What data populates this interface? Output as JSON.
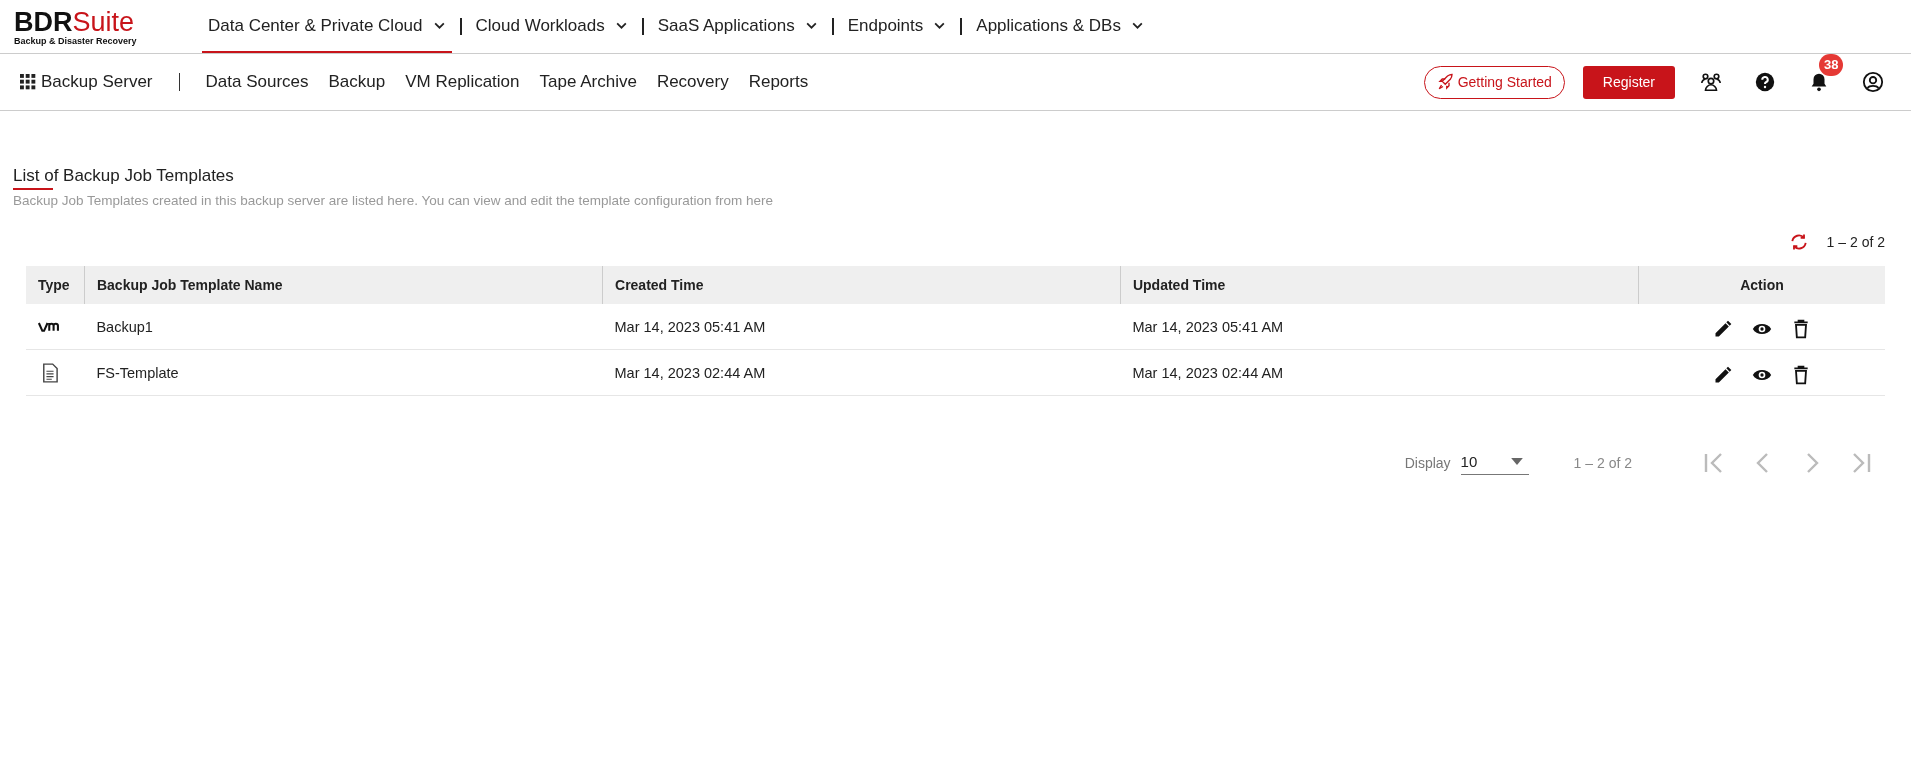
{
  "logo": {
    "name_dark": "BDR",
    "name_accent": "Suite",
    "tagline": "Backup & Disaster Recovery"
  },
  "product_nav": [
    {
      "label": "Data Center & Private Cloud",
      "selected": true
    },
    {
      "label": "Cloud Workloads",
      "selected": false
    },
    {
      "label": "SaaS Applications",
      "selected": false
    },
    {
      "label": "Endpoints",
      "selected": false
    },
    {
      "label": "Applications & DBs",
      "selected": false
    }
  ],
  "app_title": "Backup Server",
  "menu": [
    "Data Sources",
    "Backup",
    "VM Replication",
    "Tape Archive",
    "Recovery",
    "Reports"
  ],
  "getting_started": "Getting Started",
  "register": "Register",
  "notification_count": "38",
  "page": {
    "title": "List of Backup Job Templates",
    "description": "Backup Job Templates created in this backup server are listed here. You can view and edit the template configuration from here"
  },
  "range_top": "1 – 2 of 2",
  "table": {
    "columns": [
      "Type",
      "Backup Job Template Name",
      "Created Time",
      "Updated Time",
      "Action"
    ],
    "rows": [
      {
        "kind": "vm",
        "name": "Backup1",
        "created": "Mar 14, 2023 05:41 AM",
        "updated": "Mar 14, 2023 05:41 AM"
      },
      {
        "kind": "file",
        "name": "FS-Template",
        "created": "Mar 14, 2023 02:44 AM",
        "updated": "Mar 14, 2023 02:44 AM"
      }
    ]
  },
  "pagination": {
    "display_label": "Display",
    "page_size": "10",
    "range": "1 – 2 of 2"
  }
}
